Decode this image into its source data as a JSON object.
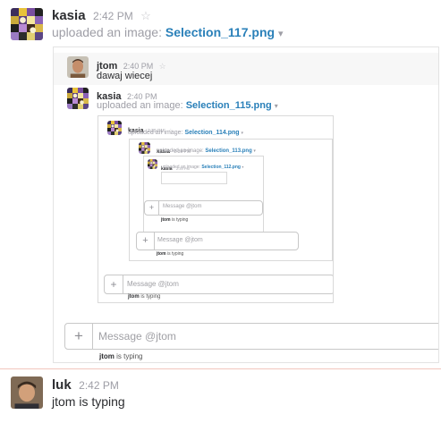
{
  "messages": {
    "top": {
      "author": "kasia",
      "time": "2:42 PM",
      "star": "☆",
      "action": "uploaded an image:",
      "file": "Selection_117.png",
      "caret": "▾"
    },
    "bottom": {
      "author": "luk",
      "time": "2:42 PM",
      "text": "jtom is typing"
    }
  },
  "shot1": {
    "jtom": {
      "author": "jtom",
      "time": "2:40 PM",
      "star": "☆",
      "text": "dawaj wiecej"
    },
    "kasia": {
      "author": "kasia",
      "time": "2:40 PM",
      "action": "uploaded an image:",
      "file": "Selection_115.png",
      "caret": "▾"
    },
    "input": {
      "plus": "+",
      "placeholder": "Message @jtom"
    },
    "typing": {
      "user": "jtom",
      "suffix": "is typing"
    }
  },
  "shot2": {
    "kasia": {
      "author": "kasia",
      "time": "2:39 PM",
      "star": "☆",
      "action": "uploaded an image:",
      "file": "Selection_114.png",
      "caret": "▾"
    },
    "input": {
      "plus": "+",
      "placeholder": "Message @jtom"
    },
    "typing": {
      "user": "jtom",
      "suffix": "is typing"
    }
  },
  "shot3": {
    "kasia": {
      "author": "kasia",
      "time": "2:39 PM",
      "action": "uploaded an image:",
      "file": "Selection_113.png",
      "caret": "▾"
    },
    "input": {
      "plus": "+",
      "placeholder": "Message @jtom"
    },
    "typing": {
      "user": "jtom",
      "suffix": "is typing"
    }
  },
  "shot4": {
    "kasia": {
      "author": "kasia",
      "time": "2:39 PM",
      "action": "uploaded an image:",
      "file": "Selection_112.png",
      "caret": "▾"
    },
    "input": {
      "plus": "+",
      "placeholder": "Message @jtom"
    },
    "typing": {
      "user": "jtom",
      "suffix": "is typing"
    }
  },
  "colors": {
    "link": "#2a80b9",
    "name": "#2c2d30",
    "muted": "#9e9ea6",
    "divider": "#f2c6bd"
  },
  "icons": [
    "kasia-avatar",
    "jtom-avatar",
    "luk-avatar",
    "star-icon",
    "caret-down-icon",
    "plus-icon"
  ]
}
